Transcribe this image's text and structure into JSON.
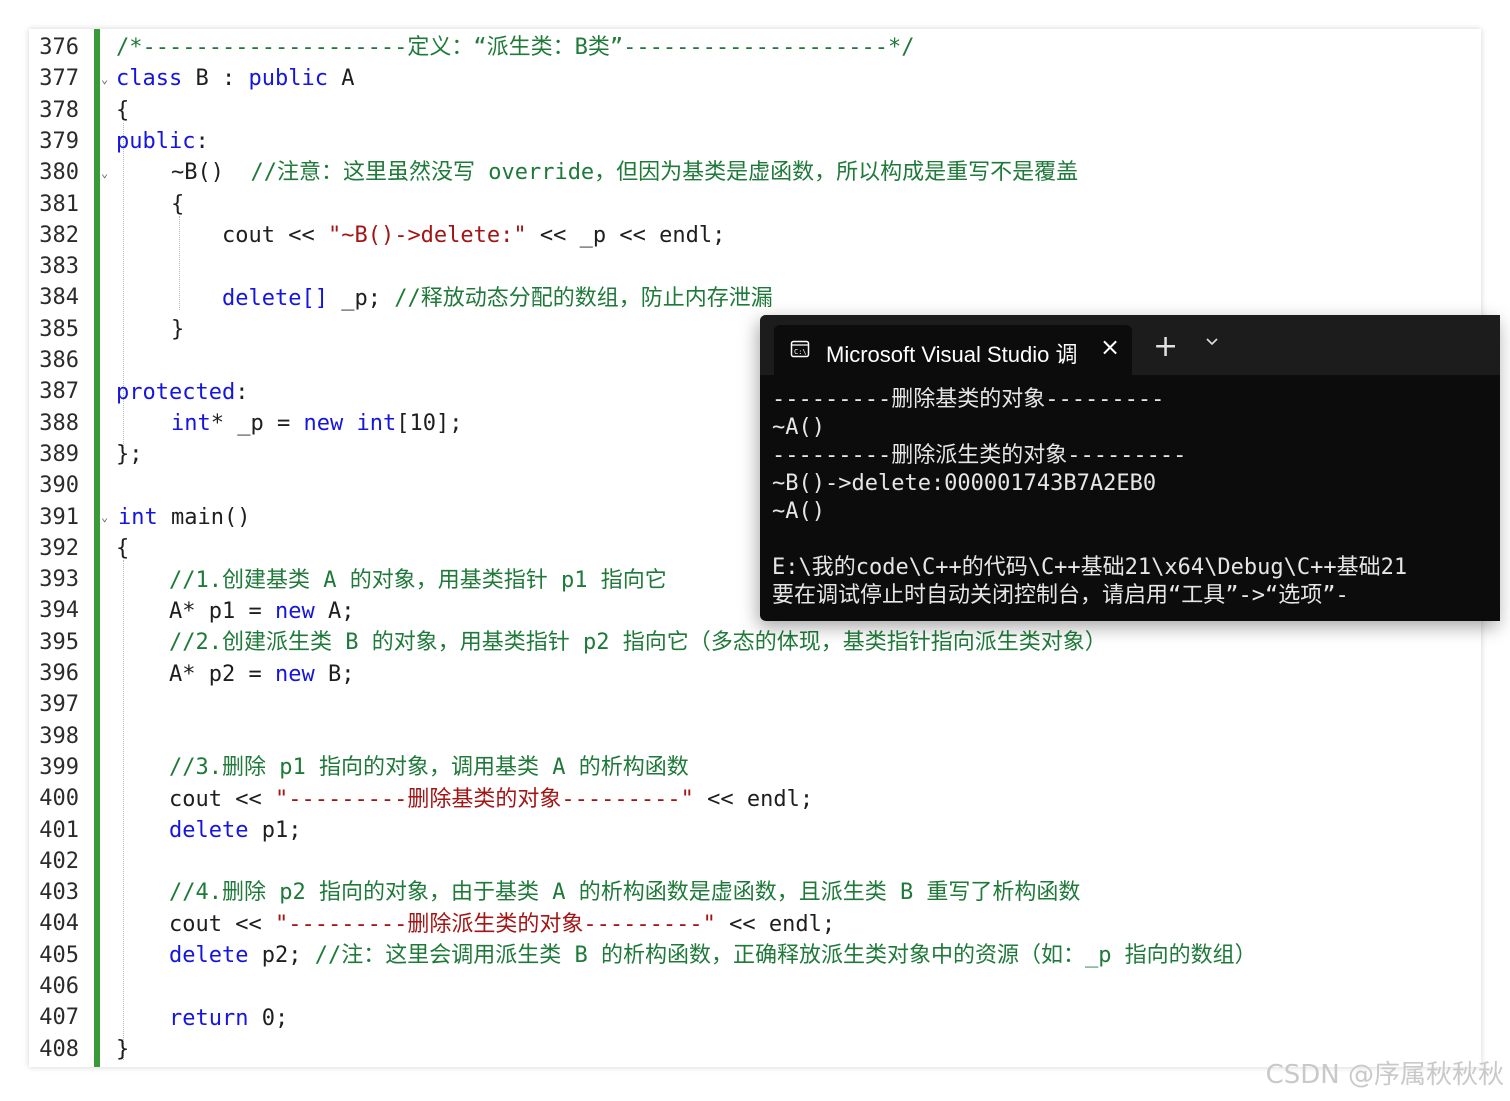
{
  "editor": {
    "line_numbers": [
      "376",
      "377",
      "378",
      "379",
      "380",
      "381",
      "382",
      "383",
      "384",
      "385",
      "386",
      "387",
      "388",
      "389",
      "390",
      "391",
      "392",
      "393",
      "394",
      "395",
      "396",
      "397",
      "398",
      "399",
      "400",
      "401",
      "402",
      "403",
      "404",
      "405",
      "406",
      "407",
      "408"
    ],
    "code": {
      "l376": "/*--------------------定义：“派生类：B类”--------------------*/",
      "l377_kw1": "class",
      "l377_t1": " B : ",
      "l377_kw2": "public",
      "l377_t2": " A",
      "l378": "{",
      "l379_kw": "public",
      "l379_t": ":",
      "l380_t": "~B()  ",
      "l380_cm": "//注意：这里虽然没写 override，但因为基类是虚函数，所以构成是重写不是覆盖",
      "l381": "{",
      "l382_t1": "cout << ",
      "l382_st": "\"~B()->delete:\"",
      "l382_t2": " << _p << endl;",
      "l384_kw": "delete[]",
      "l384_t": " _p; ",
      "l384_cm": "//释放动态分配的数组，防止内存泄漏",
      "l385": "}",
      "l387_kw": "protected",
      "l387_t": ":",
      "l388_kw1": "int",
      "l388_t1": "* _p = ",
      "l388_kw2": "new",
      "l388_t2": " ",
      "l388_kw3": "int",
      "l388_t3": "[10];",
      "l389": "};",
      "l391_kw": "int",
      "l391_t": " main()",
      "l392": "{",
      "l393": "//1.创建基类 A 的对象，用基类指针 p1 指向它",
      "l394_t1": "A* p1 = ",
      "l394_kw": "new",
      "l394_t2": " A;",
      "l395": "//2.创建派生类 B 的对象，用基类指针 p2 指向它（多态的体现，基类指针指向派生类对象）",
      "l396_t1": "A* p2 = ",
      "l396_kw": "new",
      "l396_t2": " B;",
      "l399": "//3.删除 p1 指向的对象，调用基类 A 的析构函数",
      "l400_t1": "cout << ",
      "l400_st": "\"---------删除基类的对象---------\"",
      "l400_t2": " << endl;",
      "l401_kw": "delete",
      "l401_t": " p1;",
      "l403": "//4.删除 p2 指向的对象，由于基类 A 的析构函数是虚函数，且派生类 B 重写了析构函数",
      "l404_t1": "cout << ",
      "l404_st": "\"---------删除派生类的对象---------\"",
      "l404_t2": " << endl;",
      "l405_kw": "delete",
      "l405_t": " p2; ",
      "l405_cm": "//注：这里会调用派生类 B 的析构函数，正确释放派生类对象中的资源（如：_p 指向的数组）",
      "l407_kw": "return",
      "l407_t": " 0;",
      "l408": "}"
    }
  },
  "console": {
    "tab_title": "Microsoft Visual Studio 调",
    "icon": "terminal-icon",
    "lines": [
      "---------删除基类的对象---------",
      "~A()",
      "---------删除派生类的对象---------",
      "~B()->delete:000001743B7A2EB0",
      "~A()",
      "",
      "E:\\我的code\\C++的代码\\C++基础21\\x64\\Debug\\C++基础21",
      "要在调试停止时自动关闭控制台，请启用“工具”->“选项”-"
    ]
  },
  "watermark": "CSDN @序属秋秋秋",
  "colors": {
    "comment": "#1f7a3a",
    "keyword": "#1515e0",
    "string": "#a31515",
    "change_bar": "#3a9a3a",
    "console_bg": "#0c0c0c"
  }
}
